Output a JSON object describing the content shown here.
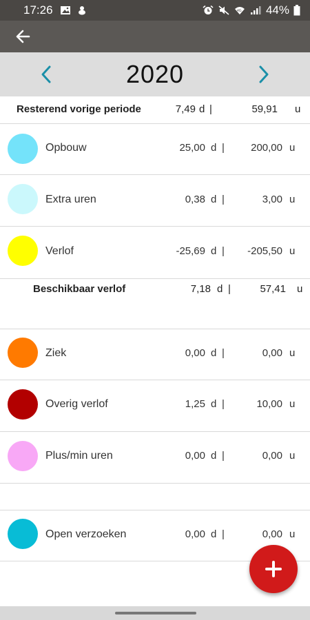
{
  "status_bar": {
    "time": "17:26",
    "battery": "44%"
  },
  "header": {
    "year": "2020"
  },
  "remaining": {
    "label": "Resterend vorige periode",
    "days": "7,49",
    "hours": "59,91"
  },
  "units": {
    "d": "d",
    "sep": "|",
    "u": "u"
  },
  "colors": {
    "accent": "#1a8fa8",
    "fab": "#d11a1a"
  },
  "rows": [
    {
      "label": "Opbouw",
      "color": "#74e3fa",
      "days": "25,00",
      "hours": "200,00"
    },
    {
      "label": "Extra uren",
      "color": "#cbf8fc",
      "days": "0,38",
      "hours": "3,00"
    },
    {
      "label": "Verlof",
      "color": "#ffff00",
      "days": "-25,69",
      "hours": "-205,50"
    },
    {
      "label": "Ziek",
      "color": "#ff7a00",
      "days": "0,00",
      "hours": "0,00"
    },
    {
      "label": "Overig verlof",
      "color": "#b20000",
      "days": "1,25",
      "hours": "10,00"
    },
    {
      "label": "Plus/min uren",
      "color": "#f8a8f6",
      "days": "0,00",
      "hours": "0,00"
    },
    {
      "label": "Open verzoeken",
      "color": "#08bcd6",
      "days": "0,00",
      "hours": "0,00"
    }
  ],
  "available": {
    "label": "Beschikbaar verlof",
    "days": "7,18",
    "hours": "57,41"
  },
  "fab": {
    "icon": "plus-icon"
  }
}
